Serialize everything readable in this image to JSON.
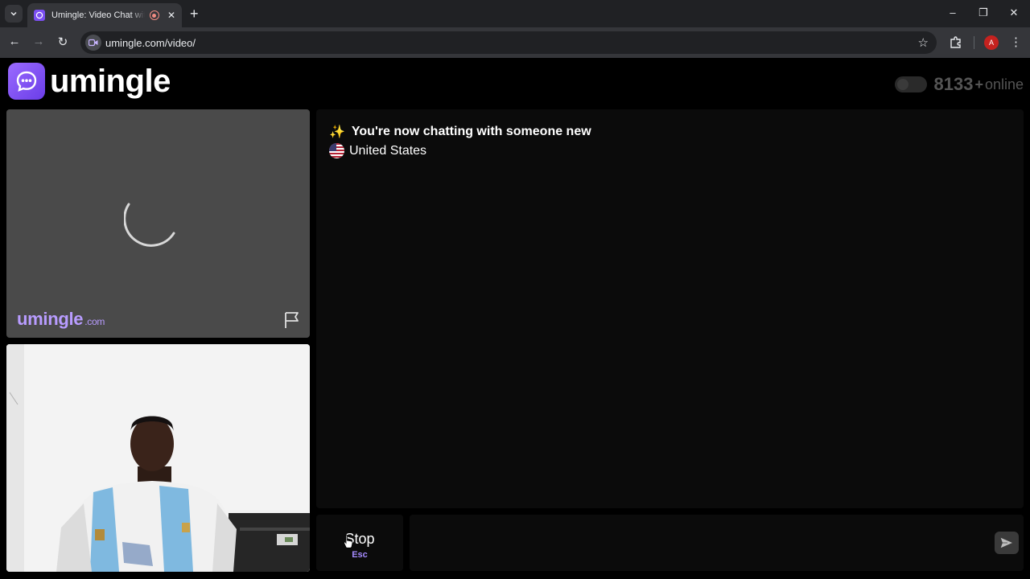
{
  "browser": {
    "tab": {
      "title": "Umingle: Video Chat with Strangers",
      "close": "✕"
    },
    "new_tab": "+",
    "window_controls": {
      "minimize": "–",
      "restore": "❐",
      "close": "✕"
    },
    "nav": {
      "back": "←",
      "forward": "→",
      "reload": "↻",
      "menu": "⋮",
      "star": "☆"
    },
    "url": "umingle.com/video/",
    "profile_initial": "A"
  },
  "header": {
    "logo_text": "umingle",
    "online_count": "8133",
    "online_plus": "+",
    "online_label": "online"
  },
  "remote_video": {
    "watermark": "umingle",
    "watermark_tld": ".com"
  },
  "chat": {
    "status_message": "You're now chatting with someone new",
    "country": "United States"
  },
  "controls": {
    "stop_label": "Stop",
    "stop_shortcut": "Esc",
    "message_placeholder": ""
  },
  "colors": {
    "brand": "#7b4ff0",
    "watermark": "#b89cff",
    "shortcut": "#a58bff"
  }
}
